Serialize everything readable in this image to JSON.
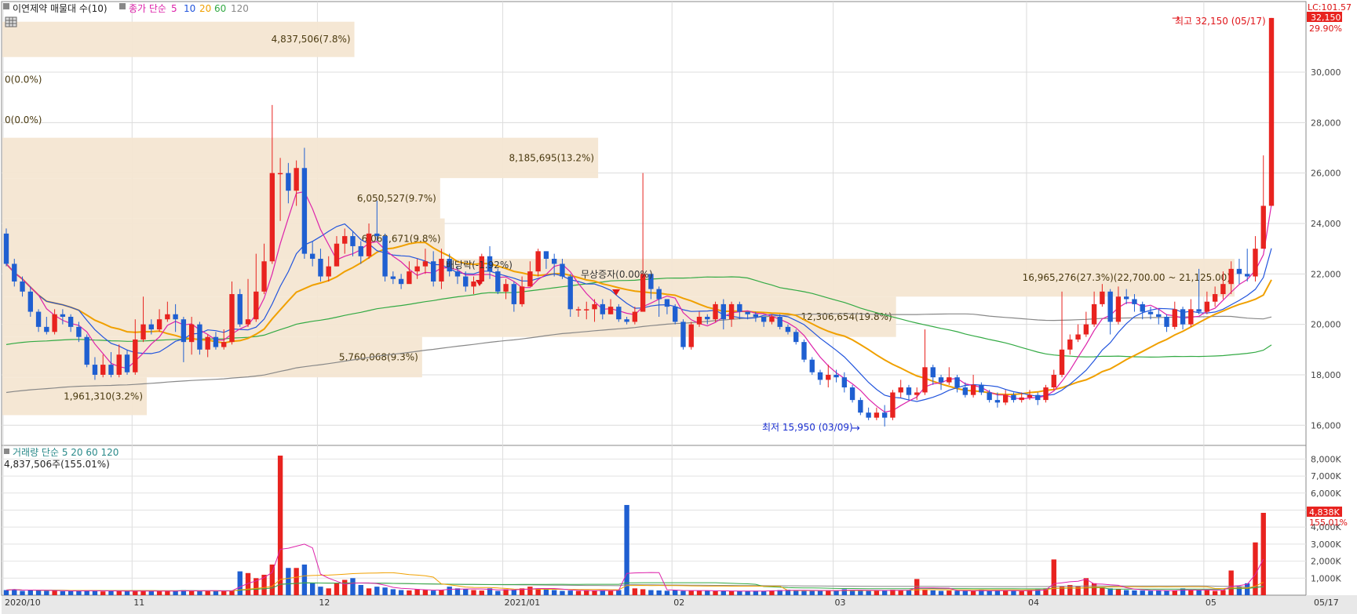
{
  "chart_data": [
    {
      "type": "candlestick",
      "title": "이연제약 매물대 수(10)",
      "legend": {
        "label": "종가 단순",
        "periods": [
          "5",
          "10",
          "20",
          "60",
          "120"
        ],
        "colors": [
          "#dd22aa",
          "#2255dd",
          "#f0a000",
          "#33aa44",
          "#888888"
        ]
      },
      "y_ticks": [
        "16,000",
        "18,000",
        "20,000",
        "22,000",
        "24,000",
        "26,000",
        "28,000",
        "30,000"
      ],
      "ylim": [
        15200,
        32800
      ],
      "x_labels": [
        "2020/10",
        "11",
        "12",
        "2021/01",
        "02",
        "03",
        "04",
        "05",
        "05/17"
      ],
      "right_top": {
        "lc": "LC:101.57",
        "price": "32,150",
        "pct": "29.90%"
      },
      "annotations": {
        "high": "최고 32,150 (05/17)",
        "low": "최저 15,950 (03/09)",
        "event1": "배당락(-1.92%)",
        "event2": "무상증자(0.00%)"
      },
      "volume_profile": [
        {
          "label": "4,837,506(7.8%)",
          "lo": 30600,
          "hi": 32000,
          "pct": 7.8
        },
        {
          "label": "0(0.0%)",
          "lo": 29000,
          "hi": 30400,
          "pct": 0.0
        },
        {
          "label": "0(0.0%)",
          "lo": 27400,
          "hi": 28800,
          "pct": 0.0
        },
        {
          "label": "8,185,695(13.2%)",
          "lo": 25800,
          "hi": 27400,
          "pct": 13.2
        },
        {
          "label": "6,050,527(9.7%)",
          "lo": 24200,
          "hi": 25800,
          "pct": 9.7
        },
        {
          "label": "6,062,671(9.8%)",
          "lo": 22600,
          "hi": 24200,
          "pct": 9.8
        },
        {
          "label": "16,965,276(27.3%)(22,700.00 ~ 21,125.00)",
          "lo": 21100,
          "hi": 22600,
          "pct": 27.3
        },
        {
          "label": "12,306,654(19.8%)",
          "lo": 19500,
          "hi": 21100,
          "pct": 19.8
        },
        {
          "label": "5,760,068(9.3%)",
          "lo": 17900,
          "hi": 19500,
          "pct": 9.3
        },
        {
          "label": "1,961,310(3.2%)",
          "lo": 16400,
          "hi": 17900,
          "pct": 3.2
        }
      ],
      "candles": [
        [
          23600,
          22400,
          23800,
          22300
        ],
        [
          22400,
          21700,
          22600,
          21500
        ],
        [
          21700,
          21300,
          21900,
          21100
        ],
        [
          21300,
          20500,
          21500,
          20300
        ],
        [
          20500,
          19900,
          20600,
          19700
        ],
        [
          19900,
          19700,
          20300,
          19600
        ],
        [
          19700,
          20400,
          20600,
          19600
        ],
        [
          20400,
          20300,
          20600,
          20000
        ],
        [
          20300,
          19900,
          20400,
          19700
        ],
        [
          19900,
          19500,
          20100,
          19300
        ],
        [
          19500,
          18400,
          19600,
          18300
        ],
        [
          18400,
          18000,
          18700,
          17800
        ],
        [
          18000,
          18400,
          18800,
          17900
        ],
        [
          18400,
          18000,
          18900,
          17900
        ],
        [
          18000,
          18800,
          19200,
          17900
        ],
        [
          18800,
          18100,
          19000,
          18000
        ],
        [
          18100,
          19400,
          20200,
          18000
        ],
        [
          19400,
          20000,
          21100,
          19300
        ],
        [
          20000,
          19800,
          20200,
          19600
        ],
        [
          19800,
          20200,
          20600,
          19700
        ],
        [
          20200,
          20400,
          20900,
          20100
        ],
        [
          20400,
          20200,
          20800,
          19700
        ],
        [
          20200,
          19300,
          20300,
          18500
        ],
        [
          19300,
          20000,
          20300,
          18800
        ],
        [
          20000,
          19000,
          20100,
          18800
        ],
        [
          19000,
          19500,
          19600,
          18700
        ],
        [
          19500,
          19100,
          19700,
          19000
        ],
        [
          19100,
          19300,
          19800,
          19000
        ],
        [
          19300,
          21200,
          21700,
          19200
        ],
        [
          21200,
          20000,
          21400,
          19900
        ],
        [
          20000,
          20200,
          21800,
          19900
        ],
        [
          20200,
          21300,
          22800,
          20100
        ],
        [
          21300,
          22500,
          23200,
          21200
        ],
        [
          22500,
          26000,
          28700,
          22400
        ],
        [
          26000,
          26000,
          26600,
          24100
        ],
        [
          26000,
          25300,
          26400,
          24800
        ],
        [
          25300,
          26200,
          26500,
          24700
        ],
        [
          26200,
          22800,
          27000,
          22600
        ],
        [
          22800,
          22600,
          23300,
          22300
        ],
        [
          22600,
          21900,
          23000,
          21700
        ],
        [
          21900,
          22300,
          22700,
          21700
        ],
        [
          22300,
          23200,
          23500,
          22300
        ],
        [
          23200,
          23500,
          23800,
          22800
        ],
        [
          23500,
          23100,
          23700,
          22700
        ],
        [
          23100,
          22700,
          23300,
          22400
        ],
        [
          22700,
          23600,
          24000,
          22600
        ],
        [
          23600,
          23500,
          24900,
          23300
        ],
        [
          23500,
          21900,
          23600,
          21700
        ],
        [
          21900,
          21800,
          22100,
          21600
        ],
        [
          21800,
          21600,
          22000,
          21400
        ],
        [
          21600,
          22100,
          22500,
          21800
        ],
        [
          22100,
          22300,
          22600,
          21800
        ],
        [
          22300,
          22500,
          23000,
          22000
        ],
        [
          22500,
          21700,
          22900,
          21500
        ],
        [
          21700,
          22600,
          23000,
          21400
        ],
        [
          22600,
          22100,
          22800,
          21900
        ],
        [
          22100,
          21900,
          22300,
          21600
        ],
        [
          21900,
          21500,
          22100,
          21300
        ],
        [
          21500,
          21700,
          21900,
          21200
        ],
        [
          21700,
          22700,
          22800,
          21600
        ],
        [
          22700,
          22100,
          23100,
          21800
        ],
        [
          22100,
          21300,
          22200,
          21200
        ],
        [
          21300,
          21600,
          21800,
          21000
        ],
        [
          21600,
          20800,
          21700,
          20500
        ],
        [
          20800,
          21500,
          21900,
          20700
        ],
        [
          21500,
          22100,
          22500,
          21600
        ],
        [
          22100,
          22900,
          23000,
          21900
        ],
        [
          22900,
          22600,
          22900,
          22200
        ],
        [
          22600,
          22400,
          22800,
          21900
        ],
        [
          22400,
          21900,
          22600,
          21800
        ],
        [
          21900,
          20600,
          22000,
          20300
        ],
        [
          20600,
          20600,
          20700,
          20300
        ],
        [
          20600,
          20600,
          20900,
          20200
        ],
        [
          20600,
          20800,
          21000,
          20100
        ],
        [
          20800,
          20400,
          21000,
          20200
        ],
        [
          20400,
          20700,
          21000,
          20400
        ],
        [
          20700,
          20200,
          20800,
          20100
        ],
        [
          20200,
          20100,
          20300,
          20000
        ],
        [
          20100,
          20500,
          20700,
          20000
        ],
        [
          20500,
          22000,
          26000,
          20500
        ],
        [
          22000,
          21400,
          21800,
          21000
        ],
        [
          21400,
          21000,
          21500,
          20300
        ],
        [
          21000,
          20700,
          21000,
          20400
        ],
        [
          20700,
          20100,
          20800,
          20000
        ],
        [
          20100,
          19100,
          20200,
          19000
        ],
        [
          19100,
          20000,
          20100,
          19000
        ],
        [
          20000,
          20300,
          20500,
          19900
        ],
        [
          20300,
          20200,
          20400,
          20000
        ],
        [
          20200,
          20800,
          20900,
          20100
        ],
        [
          20800,
          20200,
          21000,
          19800
        ],
        [
          20200,
          20800,
          20900,
          19900
        ],
        [
          20800,
          20500,
          20900,
          20200
        ],
        [
          20500,
          20400,
          20500,
          20200
        ],
        [
          20400,
          20300,
          20500,
          20100
        ],
        [
          20300,
          20100,
          20300,
          19900
        ],
        [
          20100,
          20300,
          20400,
          20000
        ],
        [
          20300,
          19900,
          20400,
          19800
        ],
        [
          19900,
          19700,
          20000,
          19600
        ],
        [
          19700,
          19300,
          19800,
          19200
        ],
        [
          19300,
          18600,
          19400,
          18500
        ],
        [
          18600,
          18100,
          18700,
          18000
        ],
        [
          18100,
          17800,
          18200,
          17600
        ],
        [
          17800,
          18000,
          18400,
          17500
        ],
        [
          18000,
          17900,
          18200,
          17700
        ],
        [
          17900,
          17500,
          18100,
          17300
        ],
        [
          17500,
          17000,
          17600,
          16900
        ],
        [
          17000,
          16500,
          17100,
          16400
        ],
        [
          16500,
          16300,
          16700,
          16200
        ],
        [
          16300,
          16500,
          16700,
          16200
        ],
        [
          16500,
          16300,
          16800,
          15950
        ],
        [
          16300,
          17300,
          17400,
          16200
        ],
        [
          17300,
          17500,
          17800,
          17100
        ],
        [
          17500,
          17200,
          17600,
          17000
        ],
        [
          17200,
          17300,
          17500,
          17000
        ],
        [
          17300,
          18300,
          19800,
          17200
        ],
        [
          18300,
          17900,
          18400,
          17600
        ],
        [
          17900,
          17700,
          18000,
          17400
        ],
        [
          17700,
          17900,
          18300,
          17600
        ],
        [
          17900,
          17500,
          18000,
          17300
        ],
        [
          17500,
          17200,
          17700,
          17100
        ],
        [
          17200,
          17600,
          18000,
          17100
        ],
        [
          17600,
          17300,
          17700,
          17200
        ],
        [
          17300,
          17000,
          17400,
          16900
        ],
        [
          17000,
          16900,
          17300,
          16700
        ],
        [
          16900,
          17200,
          17400,
          16800
        ],
        [
          17200,
          17000,
          17300,
          16900
        ],
        [
          17000,
          17100,
          17300,
          16900
        ],
        [
          17100,
          17200,
          17400,
          17000
        ],
        [
          17200,
          17000,
          17300,
          16800
        ],
        [
          17000,
          17500,
          17600,
          16900
        ],
        [
          17500,
          18000,
          18200,
          17400
        ],
        [
          18000,
          19000,
          21300,
          17900
        ],
        [
          19000,
          19400,
          19600,
          18800
        ],
        [
          19400,
          19600,
          20000,
          19300
        ],
        [
          19600,
          20000,
          20500,
          19500
        ],
        [
          20000,
          20800,
          21300,
          19900
        ],
        [
          20800,
          21300,
          21600,
          20700
        ],
        [
          21300,
          20100,
          21400,
          19600
        ],
        [
          20100,
          21100,
          21500,
          20000
        ],
        [
          21100,
          21000,
          21400,
          20800
        ],
        [
          21000,
          20800,
          21200,
          20500
        ],
        [
          20800,
          20500,
          20900,
          20200
        ],
        [
          20500,
          20400,
          20700,
          20200
        ],
        [
          20400,
          20300,
          20600,
          20000
        ],
        [
          20300,
          19900,
          20400,
          19700
        ],
        [
          19900,
          20600,
          20900,
          19800
        ],
        [
          20600,
          20000,
          20700,
          19800
        ],
        [
          20000,
          20600,
          21000,
          19900
        ],
        [
          20600,
          20500,
          22200,
          20400
        ],
        [
          20500,
          20900,
          21300,
          20400
        ],
        [
          20900,
          21200,
          21500,
          20700
        ],
        [
          21200,
          21600,
          22100,
          21000
        ],
        [
          21600,
          22200,
          22500,
          21200
        ],
        [
          22200,
          22000,
          22600,
          21600
        ],
        [
          22000,
          21900,
          23000,
          21700
        ],
        [
          21900,
          23000,
          23500,
          21700
        ],
        [
          23000,
          24700,
          26700,
          23000
        ],
        [
          24700,
          32150,
          32150,
          24700
        ]
      ],
      "volume": {
        "title": "거래량 단순 5 20 60 120",
        "info": "4,837,506주(155.01%)",
        "y_ticks": [
          "1,000K",
          "2,000K",
          "3,000K",
          "4,000K",
          "5,000K",
          "6,000K",
          "7,000K",
          "8,000K"
        ],
        "ylim": [
          0,
          8800
        ],
        "right_value": "4,838K",
        "right_pct": "155.01%",
        "values": [
          300,
          350,
          250,
          300,
          280,
          250,
          270,
          230,
          240,
          260,
          300,
          250,
          220,
          240,
          230,
          260,
          250,
          240,
          230,
          240,
          250,
          260,
          300,
          250,
          240,
          270,
          250,
          240,
          260,
          1400,
          1300,
          1000,
          1200,
          1800,
          8200,
          1600,
          1600,
          1800,
          700,
          500,
          400,
          700,
          900,
          1000,
          600,
          400,
          500,
          450,
          350,
          300,
          280,
          350,
          300,
          270,
          300,
          500,
          400,
          350,
          300,
          270,
          400,
          250,
          350,
          300,
          400,
          500,
          400,
          350,
          300,
          250,
          270,
          250,
          300,
          260,
          300,
          250,
          300,
          5300,
          400,
          350,
          300,
          280,
          260,
          300,
          250,
          280,
          270,
          260,
          240,
          250,
          230,
          250,
          240,
          260,
          250,
          280,
          300,
          320,
          280,
          250,
          260,
          270,
          300,
          280,
          350,
          300,
          260,
          250,
          280,
          300,
          320,
          280,
          300,
          950,
          300,
          280,
          250,
          270,
          260,
          250,
          240,
          300,
          250,
          280,
          270,
          250,
          240,
          300,
          350,
          400,
          2100,
          500,
          600,
          500,
          1000,
          700,
          450,
          400,
          350,
          300,
          280,
          270,
          260,
          300,
          250,
          270,
          400,
          300,
          280,
          300,
          250,
          300,
          1450,
          500,
          700,
          3100,
          4838
        ]
      }
    }
  ]
}
